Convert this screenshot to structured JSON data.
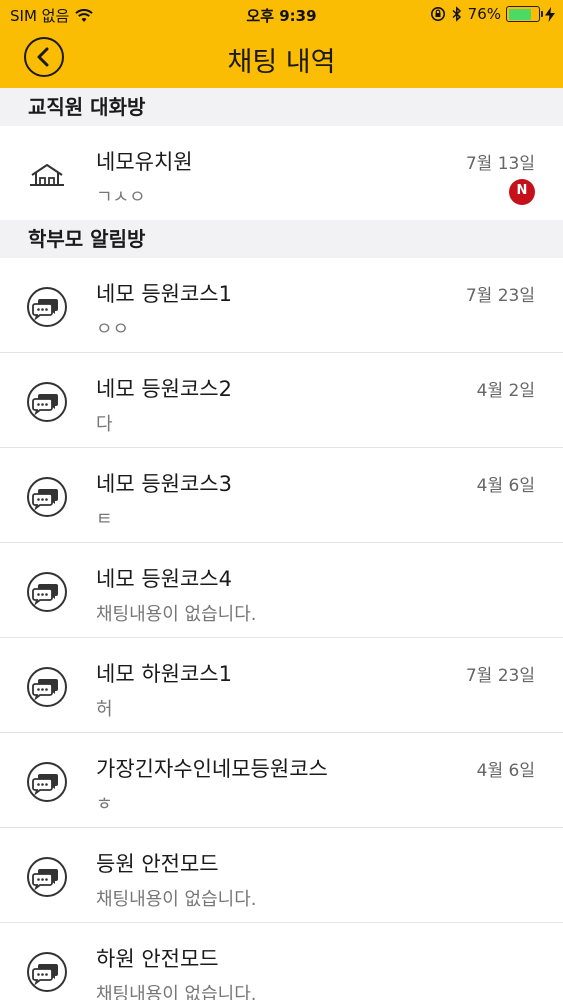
{
  "status_bar": {
    "carrier": "SIM 없음",
    "time": "오후 9:39",
    "battery": "76%",
    "battery_level": 0.76,
    "battery_color": "#4cd964"
  },
  "header": {
    "title": "채팅 내역",
    "back_icon": "back-chevron-circle-icon",
    "color": "#fbbc04"
  },
  "sections": [
    {
      "label": "교직원 대화방",
      "rooms": [
        {
          "name": "네모유치원",
          "message": "ㄱㅅㅇ",
          "date": "7월 13일",
          "badge": "N",
          "icon": "kindergarten-house-icon"
        }
      ]
    },
    {
      "label": "학부모 알림방",
      "rooms": [
        {
          "name": "네모 등원코스1",
          "message": "ㅇㅇ",
          "date": "7월 23일",
          "icon": "chat-bubbles-icon"
        },
        {
          "name": "네모 등원코스2",
          "message": "다",
          "date": "4월 2일",
          "icon": "chat-bubbles-icon"
        },
        {
          "name": "네모 등원코스3",
          "message": "ㅌ",
          "date": "4월 6일",
          "icon": "chat-bubbles-icon"
        },
        {
          "name": "네모 등원코스4",
          "message": "채팅내용이 없습니다.",
          "date": "",
          "icon": "chat-bubbles-icon"
        },
        {
          "name": "네모 하원코스1",
          "message": "허",
          "date": "7월 23일",
          "icon": "chat-bubbles-icon"
        },
        {
          "name": "가장긴자수인네모등원코스",
          "message": "ㅎ",
          "date": "4월 6일",
          "icon": "chat-bubbles-icon"
        },
        {
          "name": "등원 안전모드",
          "message": "채팅내용이 없습니다.",
          "date": "",
          "icon": "chat-bubbles-icon"
        },
        {
          "name": "하원 안전모드",
          "message": "채팅내용이 없습니다.",
          "date": "",
          "icon": "chat-bubbles-icon"
        }
      ]
    }
  ],
  "badge_color": "#c4111b"
}
